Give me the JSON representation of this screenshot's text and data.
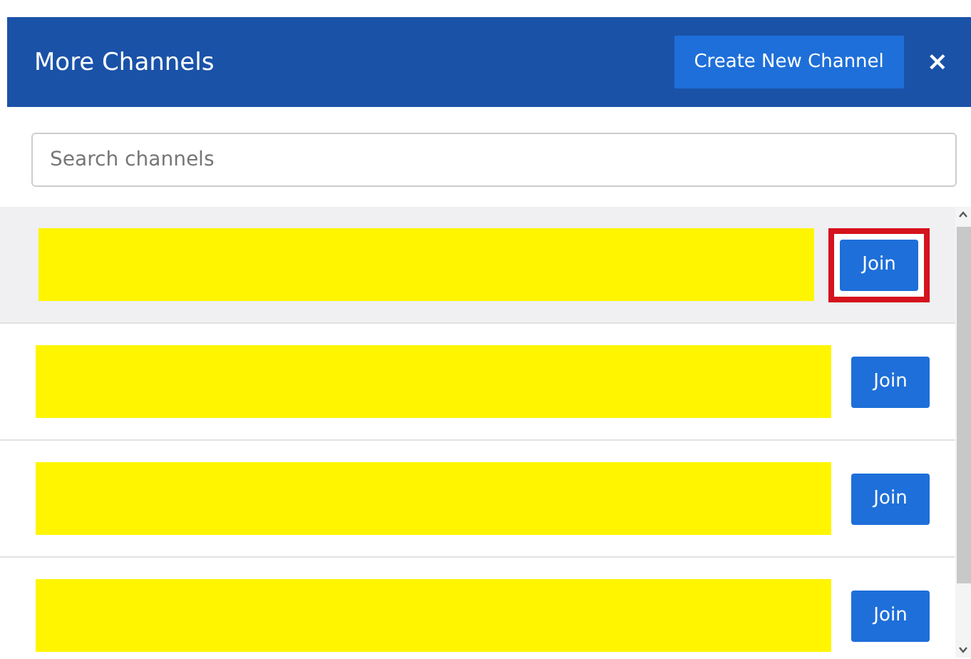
{
  "dialog": {
    "title": "More Channels",
    "create_button": "Create New Channel",
    "close": "×"
  },
  "search": {
    "placeholder": "Search channels"
  },
  "channels": [
    {
      "selected": true,
      "marked": true,
      "button": "Join"
    },
    {
      "selected": false,
      "marked": false,
      "button": "Join"
    },
    {
      "selected": false,
      "marked": false,
      "button": "Join"
    },
    {
      "selected": false,
      "marked": false,
      "button": "Join"
    }
  ]
}
